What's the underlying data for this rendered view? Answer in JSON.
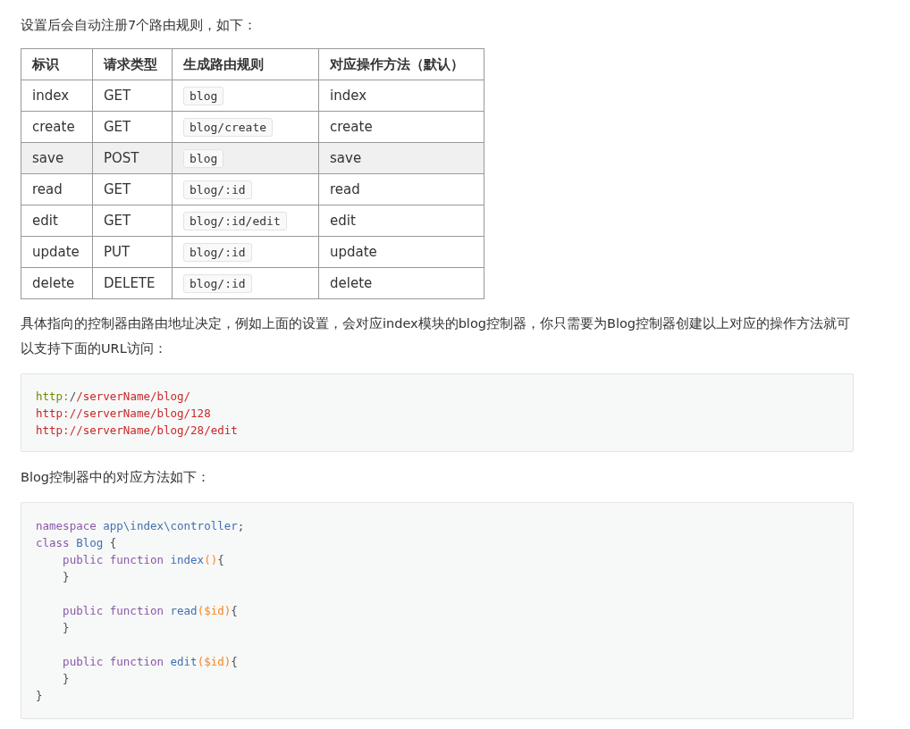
{
  "intro": "设置后会自动注册7个路由规则，如下：",
  "table": {
    "columns": [
      "标识",
      "请求类型",
      "生成路由规则",
      "对应操作方法（默认）"
    ],
    "rows": [
      {
        "cells": [
          "index",
          "GET",
          "blog",
          "index"
        ],
        "selected": false
      },
      {
        "cells": [
          "create",
          "GET",
          "blog/create",
          "create"
        ],
        "selected": false
      },
      {
        "cells": [
          "save",
          "POST",
          "blog",
          "save"
        ],
        "selected": true
      },
      {
        "cells": [
          "read",
          "GET",
          "blog/:id",
          "read"
        ],
        "selected": false
      },
      {
        "cells": [
          "edit",
          "GET",
          "blog/:id/edit",
          "edit"
        ],
        "selected": false
      },
      {
        "cells": [
          "update",
          "PUT",
          "blog/:id",
          "update"
        ],
        "selected": false
      },
      {
        "cells": [
          "delete",
          "DELETE",
          "blog/:id",
          "delete"
        ],
        "selected": false
      }
    ]
  },
  "para": "具体指向的控制器由路由地址决定，例如上面的设置，会对应index模块的blog控制器，你只需要为Blog控制器创建以上对应的操作方法就可以支持下面的URL访问：",
  "url_block": [
    {
      "kind": "code",
      "tokens": [
        {
          "kind": "scheme",
          "text": "http:"
        },
        {
          "kind": "plain",
          "text": "/"
        },
        {
          "kind": "string",
          "text": "/serverName/blog/"
        }
      ]
    },
    {
      "kind": "code",
      "tokens": [
        {
          "kind": "string",
          "text": "http://serverName/blog/128"
        }
      ]
    },
    {
      "kind": "code",
      "tokens": [
        {
          "kind": "string",
          "text": "http://serverName/blog/28/edit"
        }
      ]
    }
  ],
  "para2": "Blog控制器中的对应方法如下：",
  "code_block": [
    {
      "kind": "code",
      "tokens": [
        {
          "kind": "keyword",
          "text": "namespace "
        },
        {
          "kind": "name",
          "text": "app\\index\\controller"
        },
        {
          "kind": "plain",
          "text": ";"
        }
      ]
    },
    {
      "kind": "code",
      "tokens": [
        {
          "kind": "keyword",
          "text": "class "
        },
        {
          "kind": "name",
          "text": "Blog"
        },
        {
          "kind": "plain",
          "text": " {"
        }
      ]
    },
    {
      "kind": "code",
      "tokens": [
        {
          "kind": "keyword",
          "text": "    public function "
        },
        {
          "kind": "name",
          "text": "index"
        },
        {
          "kind": "param",
          "text": "()"
        },
        {
          "kind": "plain",
          "text": "{"
        }
      ]
    },
    {
      "kind": "code",
      "tokens": [
        {
          "kind": "plain",
          "text": "    }"
        }
      ]
    },
    {
      "kind": "blank"
    },
    {
      "kind": "code",
      "tokens": [
        {
          "kind": "keyword",
          "text": "    public function "
        },
        {
          "kind": "name",
          "text": "read"
        },
        {
          "kind": "param",
          "text": "($id)"
        },
        {
          "kind": "plain",
          "text": "{"
        }
      ]
    },
    {
      "kind": "code",
      "tokens": [
        {
          "kind": "plain",
          "text": "    }"
        }
      ]
    },
    {
      "kind": "blank"
    },
    {
      "kind": "code",
      "tokens": [
        {
          "kind": "keyword",
          "text": "    public function "
        },
        {
          "kind": "name",
          "text": "edit"
        },
        {
          "kind": "param",
          "text": "($id)"
        },
        {
          "kind": "plain",
          "text": "{"
        }
      ]
    },
    {
      "kind": "code",
      "tokens": [
        {
          "kind": "plain",
          "text": "    }"
        }
      ]
    },
    {
      "kind": "code",
      "tokens": [
        {
          "kind": "plain",
          "text": "}"
        }
      ]
    }
  ]
}
